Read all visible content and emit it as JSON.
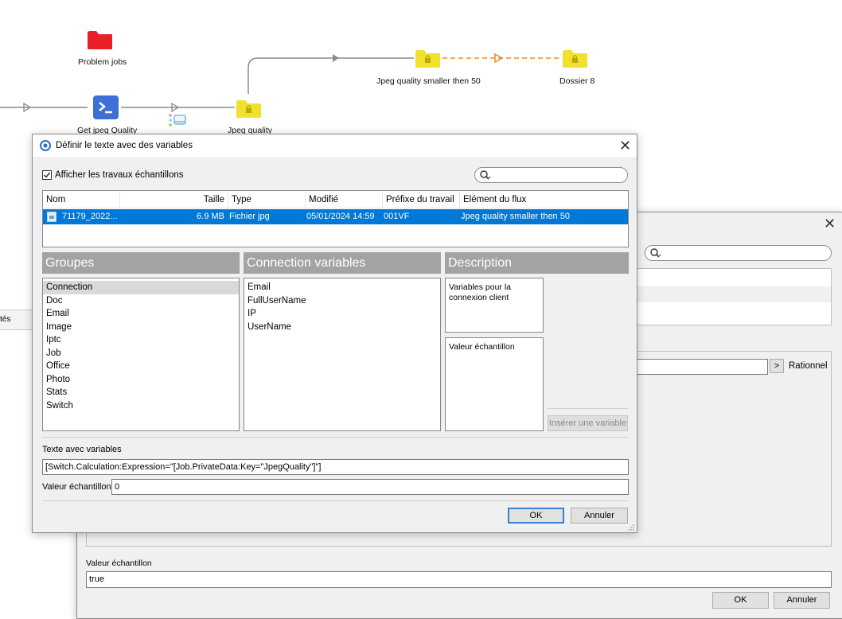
{
  "flow": {
    "problem_jobs": "Problem jobs",
    "get_jpeg_quality": "Get jpeg Quality",
    "jpeg_quality": "Jpeg quality",
    "jpeg_smaller": "Jpeg quality smaller then 50",
    "dossier8": "Dossier 8"
  },
  "bg_window": {
    "left_fragment": "tés",
    "rationnel_label": "Rationnel",
    "arrow_btn": ">",
    "sample_label": "Valeur échantillon",
    "sample_value": "true",
    "ok": "OK",
    "cancel": "Annuler"
  },
  "dialog": {
    "title": "Définir le texte avec des variables",
    "show_samples_label": "Afficher les travaux échantillons",
    "show_samples_checked": true,
    "search_value": "",
    "columns": [
      "Nom",
      "Taille",
      "Type",
      "Modifié",
      "Préfixe du travail",
      "Elément du flux"
    ],
    "row": {
      "name": "71179_2022...",
      "size": "6.9 MB",
      "type": "Fichier jpg",
      "modified": "05/01/2024 14:59",
      "prefix": "001VF",
      "element": "Jpeg quality smaller then 50"
    },
    "groups_header": "Groupes",
    "groups": [
      "Connection",
      "Doc",
      "Email",
      "Image",
      "Iptc",
      "Job",
      "Office",
      "Photo",
      "Stats",
      "Switch"
    ],
    "vars_header": "Connection variables",
    "vars": [
      "Email",
      "FullUserName",
      "IP",
      "UserName"
    ],
    "desc_header": "Description",
    "desc_text": "Variables pour la connexion client",
    "sample_box_label": "Valeur échantillon",
    "insert_button": "Insérer une variable",
    "text_label": "Texte avec variables",
    "text_value": "[Switch.Calculation:Expression=\"[Job.PrivateData:Key=\"JpegQuality\"]\"]",
    "sample_label": "Valeur échantillon",
    "sample_value": "0",
    "ok": "OK",
    "cancel": "Annuler"
  },
  "colors": {
    "selection": "#0078d7",
    "folder_yellow": "#f2e12c",
    "folder_red": "#e8202a",
    "script_blue": "#3d6fd6",
    "dashed_orange": "#f08a2c"
  }
}
